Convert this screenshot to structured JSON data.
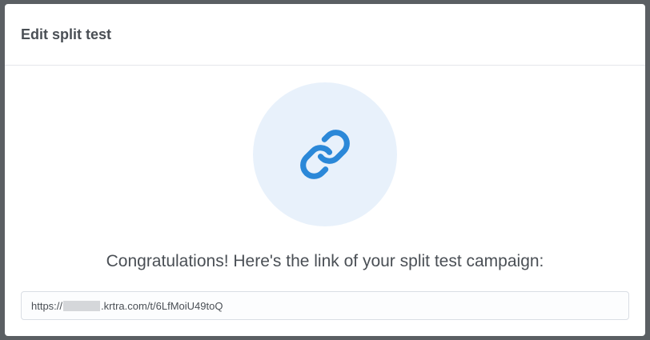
{
  "modal": {
    "title": "Edit split test"
  },
  "icon": {
    "name": "link-icon",
    "color": "#2b88d8",
    "background": "#e8f1fb"
  },
  "message": "Congratulations! Here's the link of your split test campaign:",
  "link": {
    "prefix": "https://",
    "suffix": ".krtra.com/t/6LfMoiU49toQ"
  }
}
